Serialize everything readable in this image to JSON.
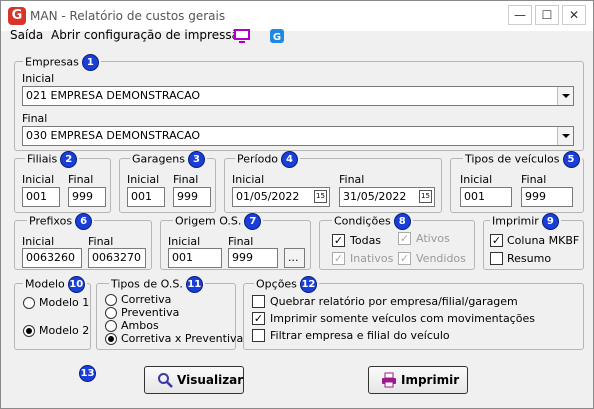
{
  "window": {
    "title": "MAN - Relatório de custos gerais",
    "minimize": "—",
    "maximize": "☐",
    "close": "✕",
    "logo": "G"
  },
  "menu": {
    "items": [
      "Saída",
      "Abrir configuração de impressão"
    ],
    "icons": [
      "monitor-icon",
      "app-logo-icon"
    ]
  },
  "empresas": {
    "legend": "Empresas",
    "badge": "1",
    "inicial_label": "Inicial",
    "inicial_value": "021 EMPRESA DEMONSTRACAO",
    "final_label": "Final",
    "final_value": "030 EMPRESA DEMONSTRACAO"
  },
  "filiais": {
    "legend": "Filiais",
    "badge": "2",
    "inicial_label": "Inicial",
    "inicial_value": "001",
    "final_label": "Final",
    "final_value": "999"
  },
  "garagens": {
    "legend": "Garagens",
    "badge": "3",
    "inicial_label": "Inicial",
    "inicial_value": "001",
    "final_label": "Final",
    "final_value": "999"
  },
  "periodo": {
    "legend": "Período",
    "badge": "4",
    "inicial_label": "Inicial",
    "inicial_value": "01/05/2022",
    "final_label": "Final",
    "final_value": "31/05/2022",
    "cal_glyph": "15"
  },
  "tipos_veiculos": {
    "legend": "Tipos de veículos",
    "badge": "5",
    "inicial_label": "Inicial",
    "inicial_value": "001",
    "final_label": "Final",
    "final_value": "999"
  },
  "prefixos": {
    "legend": "Prefixos",
    "badge": "6",
    "inicial_label": "Inicial",
    "inicial_value": "0063260",
    "final_label": "Final",
    "final_value": "0063270"
  },
  "origem": {
    "legend": "Origem O.S.",
    "badge": "7",
    "inicial_label": "Inicial",
    "inicial_value": "001",
    "final_label": "Final",
    "final_value": "999",
    "ellipsis": "..."
  },
  "condicoes": {
    "legend": "Condições",
    "badge": "8",
    "todas": "Todas",
    "ativos": "Ativos",
    "inativos": "Inativos",
    "vendidos": "Vendidos"
  },
  "imprimir_grp": {
    "legend": "Imprimir",
    "badge": "9",
    "coluna": "Coluna MKBF",
    "resumo": "Resumo"
  },
  "modelo": {
    "legend": "Modelo",
    "badge": "10",
    "modelo1": "Modelo 1",
    "modelo2": "Modelo 2"
  },
  "tipos_os": {
    "legend": "Tipos de O.S.",
    "badge": "11",
    "options": [
      "Corretiva",
      "Preventiva",
      "Ambos",
      "Corretiva x Preventiva"
    ]
  },
  "opcoes": {
    "legend": "Opções",
    "badge": "12",
    "options": [
      "Quebrar relatório por empresa/filial/garagem",
      "Imprimir somente veículos com movimentações",
      "Filtrar empresa e filial do veículo"
    ]
  },
  "footer": {
    "badge": "13",
    "visualizar": "Visualizar",
    "imprimir": "Imprimir"
  },
  "colors": {
    "badge": "#1a3fd8",
    "logo": "#d9342b",
    "monitor": "#b000c8",
    "print_icon": "#9b1a8a"
  }
}
